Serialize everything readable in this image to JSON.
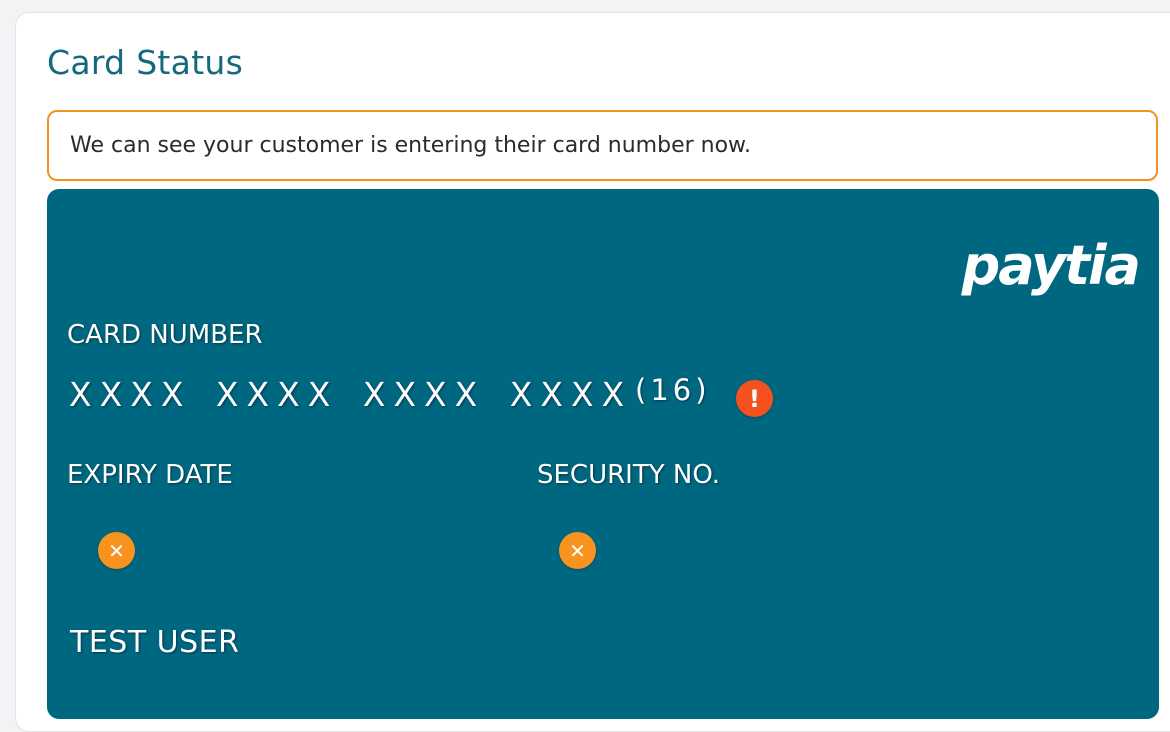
{
  "panel": {
    "title": "Card Status"
  },
  "alert": {
    "message": "We can see your customer is entering their card number now.",
    "border_color": "#f0921e"
  },
  "card": {
    "background_color": "#006780",
    "brand_logo_text": "paytia",
    "card_number": {
      "label": "CARD NUMBER",
      "value": "XXXX XXXX XXXX XXXX",
      "digit_count": "(16)",
      "status_icon": "exclamation-icon",
      "status_color": "#f5511e"
    },
    "expiry_date": {
      "label": "EXPIRY DATE",
      "status_icon": "x-icon",
      "status_symbol": "✕",
      "status_color": "#f7931e"
    },
    "security_no": {
      "label": "SECURITY NO.",
      "status_icon": "x-icon",
      "status_symbol": "✕",
      "status_color": "#f7931e"
    },
    "cardholder_name": "TEST USER"
  },
  "colors": {
    "title": "#14697d",
    "accent_orange": "#f0921e"
  }
}
